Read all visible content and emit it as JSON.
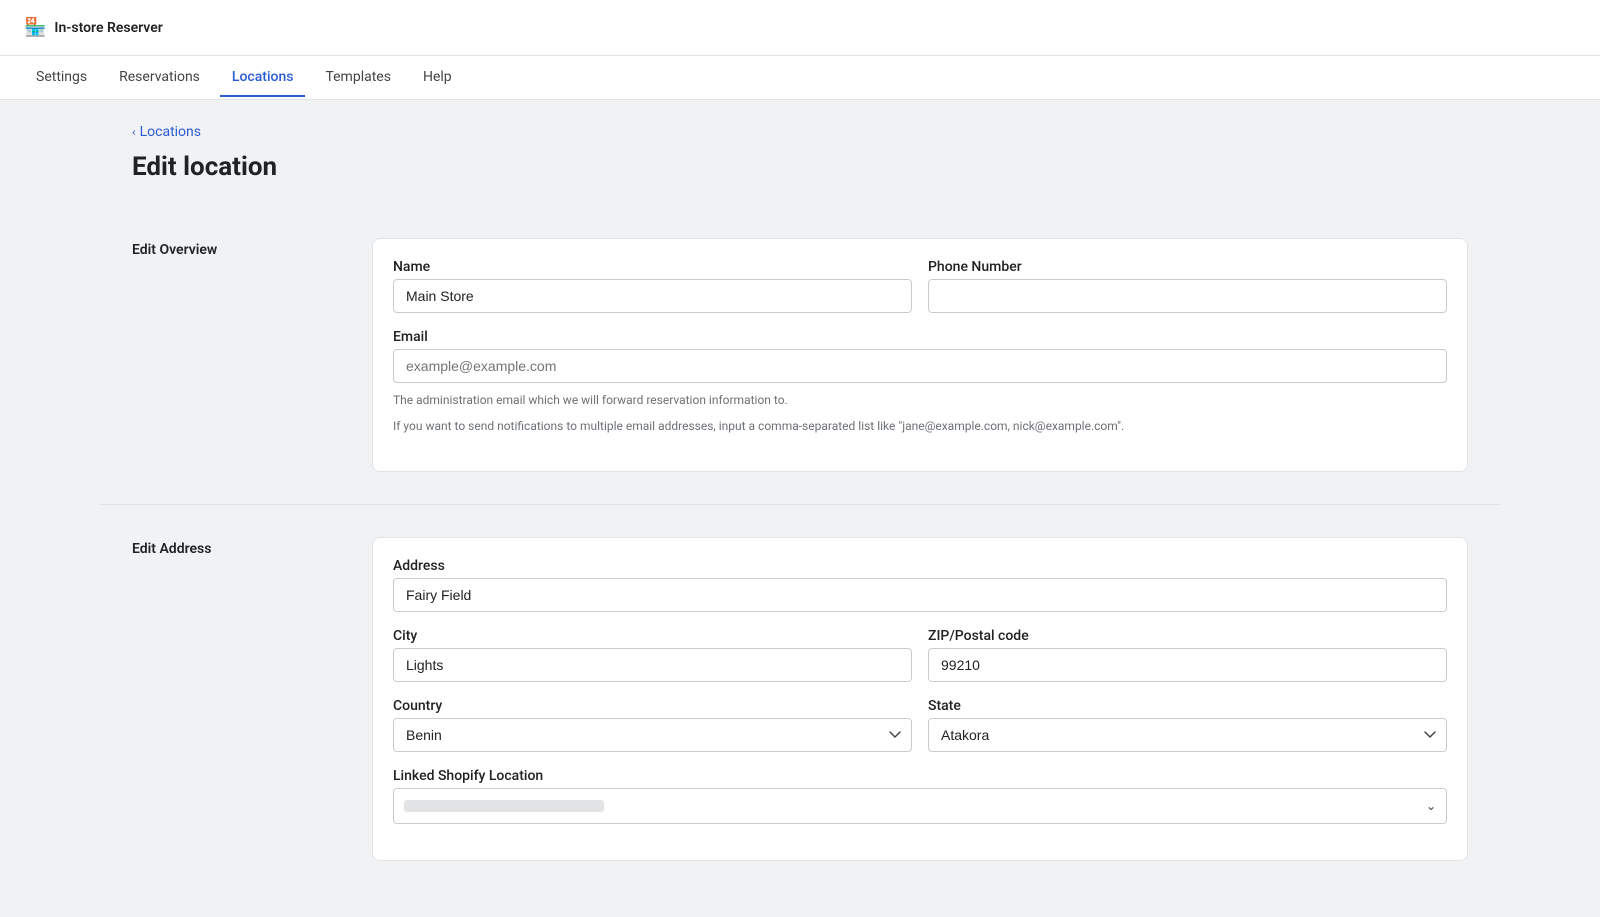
{
  "app": {
    "name": "In-store Reserver",
    "logo_icon": "🏪"
  },
  "nav": {
    "items": [
      {
        "label": "Settings",
        "active": false
      },
      {
        "label": "Reservations",
        "active": false
      },
      {
        "label": "Locations",
        "active": true
      },
      {
        "label": "Templates",
        "active": false
      },
      {
        "label": "Help",
        "active": false
      }
    ]
  },
  "breadcrumb": {
    "label": "Locations",
    "chevron": "‹"
  },
  "page": {
    "title": "Edit location"
  },
  "edit_overview": {
    "section_label": "Edit Overview",
    "name_label": "Name",
    "name_value": "Main Store",
    "phone_label": "Phone Number",
    "phone_value": "",
    "email_label": "Email",
    "email_placeholder": "example@example.com",
    "email_hint_1": "The administration email which we will forward reservation information to.",
    "email_hint_2": "If you want to send notifications to multiple email addresses, input a comma-separated list like \"jane@example.com, nick@example.com\"."
  },
  "edit_address": {
    "section_label": "Edit Address",
    "address_label": "Address",
    "address_value": "Fairy Field",
    "city_label": "City",
    "city_value": "Lights",
    "zip_label": "ZIP/Postal code",
    "zip_value": "99210",
    "country_label": "Country",
    "country_value": "Benin",
    "state_label": "State",
    "state_value": "Atakora",
    "linked_shopify_label": "Linked Shopify Location",
    "linked_shopify_value": ""
  }
}
